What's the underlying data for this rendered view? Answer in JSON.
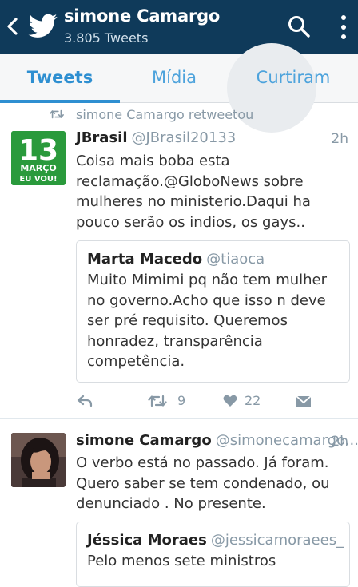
{
  "header": {
    "title": "simone Camargo",
    "subtitle": "3.805 Tweets"
  },
  "tabs": [
    {
      "label": "Tweets",
      "active": true
    },
    {
      "label": "Mídia",
      "active": false
    },
    {
      "label": "Curtiram",
      "active": false
    }
  ],
  "colors": {
    "app_bar": "#0f3a5a",
    "accent": "#2e8fd1",
    "muted_text": "#8899a6"
  },
  "tweets": [
    {
      "retweet_note": "simone Camargo retweetou",
      "avatar": {
        "line1": "13",
        "line2": "MARÇO",
        "line3": "EU VOU!"
      },
      "name": "JBrasil",
      "handle": "@JBrasil20133",
      "time": "2h",
      "body": "Coisa mais boba esta reclamação.@GloboNews  sobre mulheres no ministerio.Daqui ha pouco serão os indios, os gays..",
      "quote": {
        "name": "Marta Macedo",
        "handle": "@tiaoca",
        "body": "Muito Mimimi pq não tem mulher no governo.Acho que isso n deve ser pré requisito. Queremos honradez, transparência competência."
      },
      "actions": {
        "retweets": "9",
        "likes": "22"
      }
    },
    {
      "name": "simone Camargo",
      "handle": "@simonecamargo...",
      "time": "2h",
      "body": "O verbo está no passado. Já foram. Quero saber se tem condenado, ou denunciado . No presente.",
      "quote": {
        "name": "Jéssica Moraes",
        "handle": "@jessicamoraees_",
        "body": "Pelo menos sete ministros"
      }
    }
  ]
}
